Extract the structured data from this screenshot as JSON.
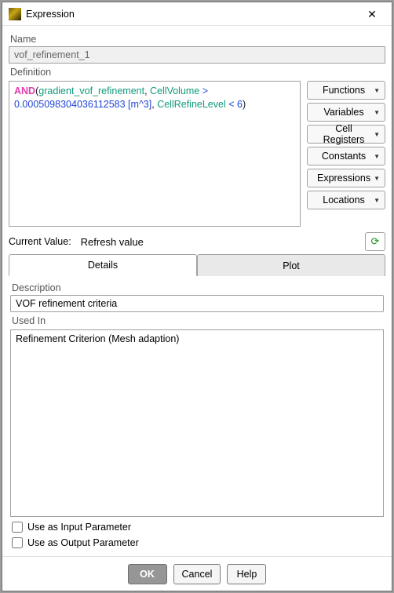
{
  "window": {
    "title": "Expression",
    "close_glyph": "✕"
  },
  "name": {
    "label": "Name",
    "value": "vof_refinement_1"
  },
  "definition": {
    "label": "Definition",
    "expr": {
      "kw": "AND",
      "lparen": "(",
      "ident1": "gradient_vof_refinement",
      "comma": ", ",
      "ident2": "CellVolume",
      "op1": " > ",
      "num1": "0.0005098304036112583 [m^3]",
      "comma2": ", ",
      "ident3": "CellRefineLevel",
      "op2": " < ",
      "num2": "6",
      "rparen": ")"
    },
    "side_buttons": [
      "Functions",
      "Variables",
      "Cell Registers",
      "Constants",
      "Expressions",
      "Locations"
    ]
  },
  "current_value": {
    "label": "Current Value:",
    "value": "Refresh value",
    "refresh_glyph": "⟳"
  },
  "tabs": {
    "details": "Details",
    "plot": "Plot"
  },
  "details": {
    "description_label": "Description",
    "description_value": "VOF refinement criteria",
    "used_in_label": "Used In",
    "used_in_value": "Refinement Criterion (Mesh adaption)",
    "chk_input_label": "Use as Input Parameter",
    "chk_output_label": "Use as Output Parameter"
  },
  "footer": {
    "ok": "OK",
    "cancel": "Cancel",
    "help": "Help"
  }
}
